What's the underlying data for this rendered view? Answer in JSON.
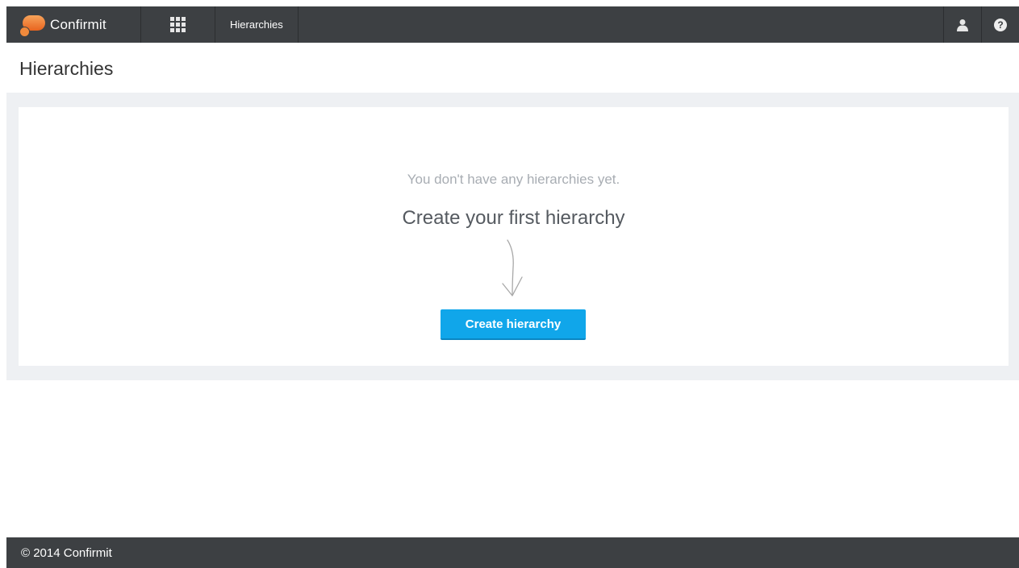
{
  "header": {
    "brand_name": "Confirmit",
    "apps_menu_icon": "grid-icon",
    "nav_tab": "Hierarchies",
    "user_icon": "user-icon",
    "help_icon": "help-icon",
    "help_glyph": "?"
  },
  "page": {
    "title": "Hierarchies"
  },
  "empty_state": {
    "message": "You don't have any hierarchies yet.",
    "heading": "Create your first hierarchy",
    "arrow_icon": "hand-drawn-arrow-down-icon",
    "button_label": "Create hierarchy"
  },
  "footer": {
    "copyright": "© 2014 Confirmit"
  },
  "colors": {
    "topbar": "#3d4043",
    "accent_button": "#10a6ea",
    "panel_bg": "#eef0f3",
    "brand_orange": "#e8641f"
  }
}
